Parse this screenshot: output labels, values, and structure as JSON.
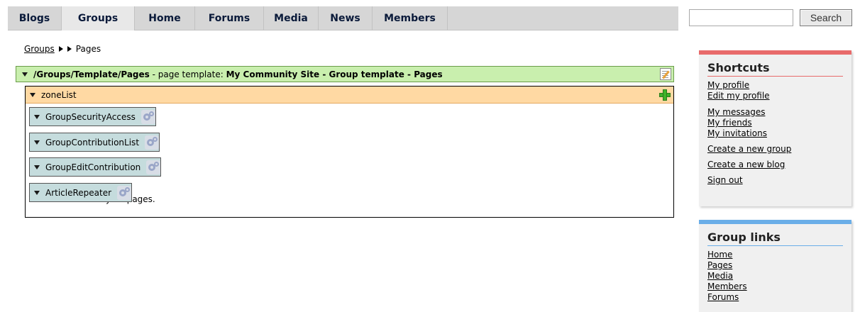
{
  "nav": {
    "tabs": [
      "Blogs",
      "Groups",
      "Home",
      "Forums",
      "Media",
      "News",
      "Members"
    ],
    "active": "Groups"
  },
  "search": {
    "value": "",
    "button_label": "Search"
  },
  "breadcrumb": {
    "link": "Groups",
    "current": "Pages"
  },
  "template_bar": {
    "path": "/Groups/Template/Pages",
    "label": " - page template: ",
    "name": "My Community Site - Group template - Pages"
  },
  "zone": {
    "name": "zoneList",
    "webparts": [
      "GroupSecurityAccess",
      "GroupContributionList",
      "GroupEditContribution",
      "ArticleRepeater"
    ],
    "empty_message": "There are currently no pages."
  },
  "shortcuts": {
    "title": "Shortcuts",
    "links": [
      "My profile",
      "Edit my profile",
      "My messages",
      "My friends",
      "My invitations",
      "Create a new group",
      "Create a new blog",
      "Sign out"
    ]
  },
  "group_links": {
    "title": "Group links",
    "links": [
      "Home",
      "Pages",
      "Media",
      "Members",
      "Forums"
    ]
  },
  "colors": {
    "template_bar_bg": "#c9efae",
    "zone_header_bg": "#ffd9a3",
    "webpart_bg": "#c5dcdd",
    "shortcuts_accent": "#e86a6a",
    "group_links_accent": "#6aaee8"
  }
}
